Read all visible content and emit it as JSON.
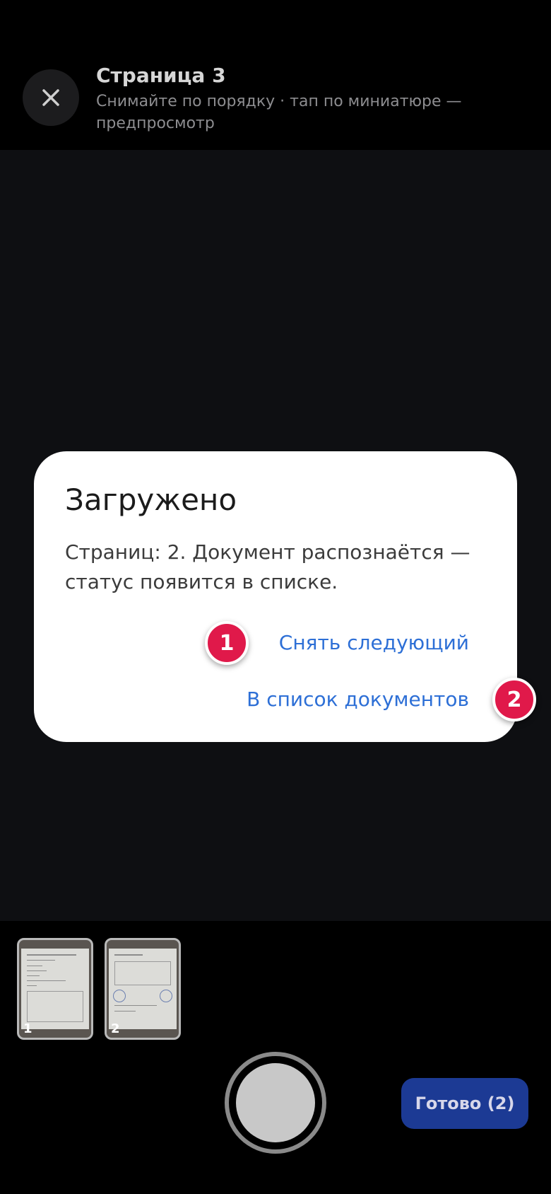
{
  "header": {
    "close_icon": "close-icon",
    "title": "Страница 3",
    "subtitle": "Снимайте по порядку · тап по миниатюре — предпросмотр"
  },
  "dialog": {
    "title": "Загружено",
    "message": "Страниц: 2. Документ распознаётся — статус появится в списке.",
    "action_next": "Снять следующий",
    "action_docs": "В список документов"
  },
  "badges": [
    "1",
    "2"
  ],
  "thumbnails": [
    {
      "number": "1"
    },
    {
      "number": "2"
    }
  ],
  "done_button": "Готово (2)",
  "colors": {
    "accent": "#2d6fd6",
    "badge": "#e0194a",
    "done_button": "#1c3a94"
  }
}
